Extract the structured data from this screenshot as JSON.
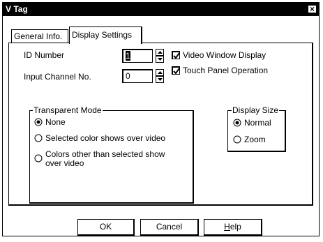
{
  "window": {
    "title": "V Tag",
    "close_glyph": "×"
  },
  "tabs": [
    {
      "label": "General Info."
    },
    {
      "label": "Display Settings"
    }
  ],
  "fields": {
    "id_number": {
      "label": "ID Number",
      "value": "1"
    },
    "input_channel": {
      "label": "Input Channel No.",
      "value": "0"
    }
  },
  "checkboxes": {
    "video_window": {
      "label": "Video Window Display",
      "checked": true
    },
    "touch_panel": {
      "label": "Touch Panel Operation",
      "checked": true
    }
  },
  "transparent_mode": {
    "title": "Transparent Mode",
    "options": [
      {
        "label": "None",
        "selected": true
      },
      {
        "label": "Selected color shows over video",
        "selected": false
      },
      {
        "label_line1": "Colors other than selected show",
        "label_line2": "over video",
        "selected": false
      }
    ]
  },
  "display_size": {
    "title": "Display Size",
    "options": [
      {
        "label": "Normal",
        "selected": true
      },
      {
        "label": "Zoom",
        "selected": false
      }
    ]
  },
  "buttons": {
    "ok": "OK",
    "cancel": "Cancel",
    "help_first": "H",
    "help_rest": "elp"
  }
}
